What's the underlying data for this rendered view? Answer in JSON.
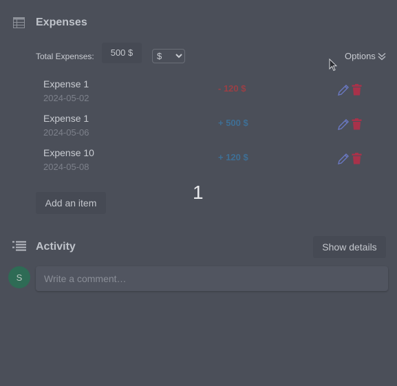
{
  "expenses": {
    "title": "Expenses",
    "total_label": "Total Expenses:",
    "total_value": "500 $",
    "currency_selected": "$",
    "options_label": "Options",
    "items": [
      {
        "name": "Expense 1",
        "date": "2024-05-02",
        "amount": "- 120 $",
        "sign": "negative"
      },
      {
        "name": "Expense 1",
        "date": "2024-05-06",
        "amount": "+ 500 $",
        "sign": "positive"
      },
      {
        "name": "Expense 10",
        "date": "2024-05-08",
        "amount": "+ 120 $",
        "sign": "positive"
      }
    ],
    "add_item_label": "Add an item"
  },
  "overlay": {
    "number": "1"
  },
  "activity": {
    "title": "Activity",
    "show_details_label": "Show details",
    "avatar_initial": "S",
    "comment_placeholder": "Write a comment…"
  },
  "icons": {
    "expenses": "table-icon",
    "activity": "list-icon",
    "options": "chevron-double-down-icon",
    "edit": "pencil-icon",
    "delete": "trash-icon",
    "cursor": "mouse-pointer-icon"
  },
  "colors": {
    "background": "#4b4f59",
    "negative_amount": "#9a3f45",
    "positive_amount": "#3e6f95",
    "delete_icon": "#a8324a",
    "edit_icon": "#6a79c4",
    "avatar": "#2e6b55"
  }
}
